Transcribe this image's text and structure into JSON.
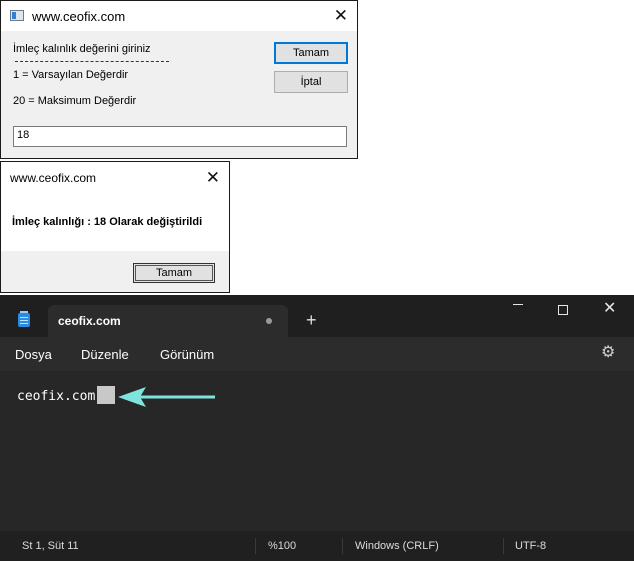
{
  "input_dialog": {
    "title": "www.ceofix.com",
    "prompt_line1": "İmleç kalınlık değerini giriniz",
    "prompt_line2": "1 = Varsayılan Değerdir",
    "prompt_line3": "20 = Maksimum Değerdir",
    "ok_label": "Tamam",
    "cancel_label": "İptal",
    "input_value": "18"
  },
  "message_box": {
    "title": "www.ceofix.com",
    "message": "İmleç kalınlığı : 18 Olarak değiştirildi",
    "ok_label": "Tamam"
  },
  "notepad": {
    "tab_title": "ceofix.com",
    "menu": [
      "Dosya",
      "Düzenle",
      "Görünüm"
    ],
    "content": "ceofix.com",
    "status": {
      "position": "St 1, Süt 11",
      "zoom": "%100",
      "line_ending": "Windows (CRLF)",
      "encoding": "UTF-8"
    },
    "arrow_color": "#7fe3de",
    "accent": "#2a8be0"
  },
  "icons": [
    "app-icon",
    "close-icon",
    "notepad-icon",
    "new-tab-icon",
    "minimize-icon",
    "maximize-icon",
    "settings-gear-icon",
    "arrow-left-icon"
  ]
}
